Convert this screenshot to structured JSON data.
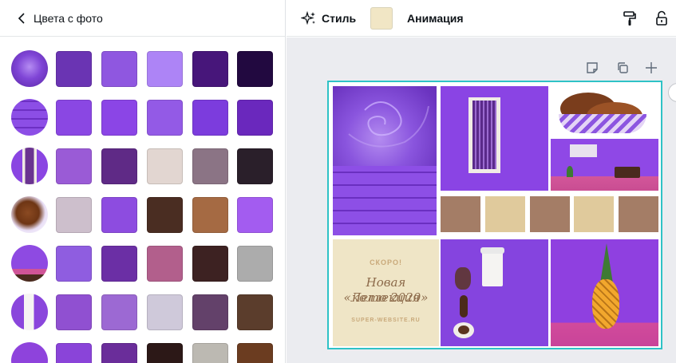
{
  "left_panel": {
    "back_label": "Цвета с фото",
    "rows": [
      {
        "photo": "purple-rose",
        "swatches": [
          "#6a34b3",
          "#8f57e0",
          "#ad84f6",
          "#47167a",
          "#220940"
        ]
      },
      {
        "photo": "purple-brick-wall",
        "swatches": [
          "#8a47e3",
          "#8b45e6",
          "#935ae6",
          "#7c3cdd",
          "#6a28bd"
        ]
      },
      {
        "photo": "purple-window",
        "swatches": [
          "#9a5bd6",
          "#5f2a86",
          "#e2d6d1",
          "#8b7485",
          "#2a1f2a"
        ]
      },
      {
        "photo": "puppies",
        "swatches": [
          "#cdbfcc",
          "#8d4ce0",
          "#4a2d22",
          "#a56a43",
          "#a35cf0"
        ]
      },
      {
        "photo": "purple-room",
        "swatches": [
          "#8f5de0",
          "#6b2fa5",
          "#b25f8c",
          "#3d2222",
          "#acacac"
        ]
      },
      {
        "photo": "coffee-cup",
        "swatches": [
          "#9050d1",
          "#9c69d3",
          "#cfc9da",
          "#63416a",
          "#5b3d2c"
        ]
      },
      {
        "photo": "pineapple",
        "swatches": [
          "#8a44d9",
          "#6a2d9a",
          "#2c1817",
          "#bcb9b2",
          "#6b3c20"
        ]
      }
    ]
  },
  "toolbar": {
    "style_label": "Стиль",
    "style_color": "#f1e6c5",
    "animation_label": "Анимация",
    "icons": [
      "sparkle-icon",
      "paint-roller-icon",
      "lock-icon"
    ]
  },
  "canvas": {
    "page_tools": [
      "note-icon",
      "duplicate-icon",
      "add-page-icon"
    ],
    "selection_color": "#2ec2c6",
    "promo": {
      "soon": "СКОРО!",
      "title_line1": "Новая коллекция",
      "title_line2": "«Лето 2020»",
      "website": "SUPER-WEBSITE.RU"
    },
    "palette_strip": [
      "#a47d66",
      "#e0ca9c",
      "#a47d66",
      "#e0ca9c",
      "#a47d66"
    ]
  }
}
